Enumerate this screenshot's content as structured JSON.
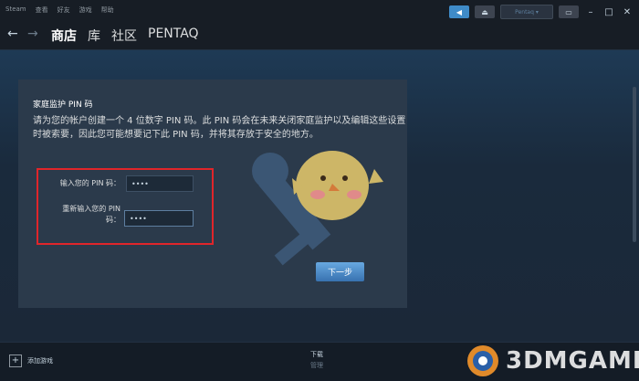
{
  "titlebar": {
    "menu": [
      "Steam",
      "查看",
      "好友",
      "游戏",
      "帮助"
    ],
    "account": "Pentaq ▾"
  },
  "nav": {
    "items": [
      "商店",
      "库",
      "社区",
      "PENTAQ"
    ],
    "active_index": 0
  },
  "panel": {
    "title": "家庭监护 PIN 码",
    "description": "请为您的帐户创建一个 4 位数字 PIN 码。此 PIN 码会在未来关闭家庭监护以及编辑这些设置时被索要，因此您可能想要记下此 PIN 码，并将其存放于安全的地方。",
    "pin_label": "输入您的 PIN 码：",
    "pin_value": "••••",
    "repin_label_line1": "重新输入您的 PIN",
    "repin_label_line2": "码：",
    "repin_value": "••••",
    "next_button": "下一步"
  },
  "bottombar": {
    "add_game": "添加游戏",
    "downloads": "下载",
    "manage": "管理"
  },
  "watermark": "3DMGAME",
  "colors": {
    "accent": "#3f8bc8",
    "highlight_box": "#e0252a",
    "background": "#1b2838"
  }
}
